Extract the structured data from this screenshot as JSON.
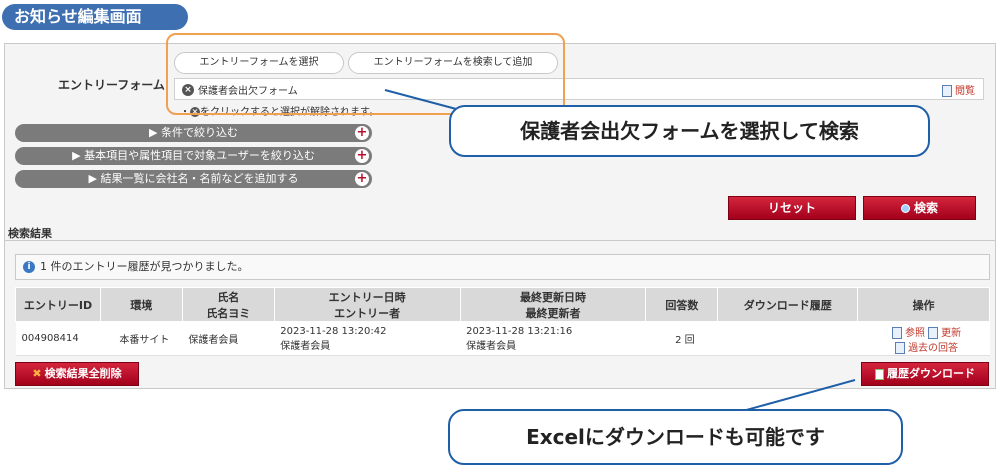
{
  "page_title": "お知らせ編集画面",
  "form": {
    "label": "エントリーフォーム",
    "tab_select": "エントリーフォームを選択",
    "tab_search_add": "エントリーフォームを検索して追加",
    "selected_item": "保護者会出欠フォーム",
    "hint": "をクリックすると選択が解除されます。",
    "view_link": "閲覧"
  },
  "filters": {
    "narrow_conditions": "▶ 条件で絞り込む",
    "narrow_users": "▶ 基本項目や属性項目で対象ユーザーを絞り込む",
    "add_columns": "▶ 結果一覧に会社名・名前などを追加する"
  },
  "callouts": {
    "select_search": "保護者会出欠フォームを選択して検索",
    "excel_download": "Excelにダウンロードも可能です"
  },
  "actions": {
    "reset": "リセット",
    "search": "検索",
    "delete_all": "検索結果全削除",
    "history_download": "履歴ダウンロード"
  },
  "results": {
    "section_label": "検索結果",
    "message": "1 件のエントリー履歴が見つかりました。",
    "headers": {
      "entry_id": "エントリーID",
      "environment": "環境",
      "name": "氏名",
      "name_kana": "氏名ヨミ",
      "entry_datetime": "エントリー日時",
      "entry_user": "エントリー者",
      "last_update": "最終更新日時",
      "last_updater": "最終更新者",
      "answer_count": "回答数",
      "download_history": "ダウンロード履歴",
      "operations": "操作"
    },
    "rows": [
      {
        "entry_id": "004908414",
        "environment": "本番サイト",
        "name": "保護者会員",
        "entry_datetime": "2023-11-28 13:20:42",
        "entry_user": "保護者会員",
        "last_update": "2023-11-28 13:21:16",
        "last_updater": "保護者会員",
        "answer_count": "2 回",
        "op_view": "参照",
        "op_update": "更新",
        "op_past": "過去の回答"
      }
    ]
  },
  "colors": {
    "title_pill": "#3e6fb0",
    "accent_red": "#b8102e",
    "callout_border": "#1f5fa8",
    "highlight_orange": "#f0a050"
  }
}
